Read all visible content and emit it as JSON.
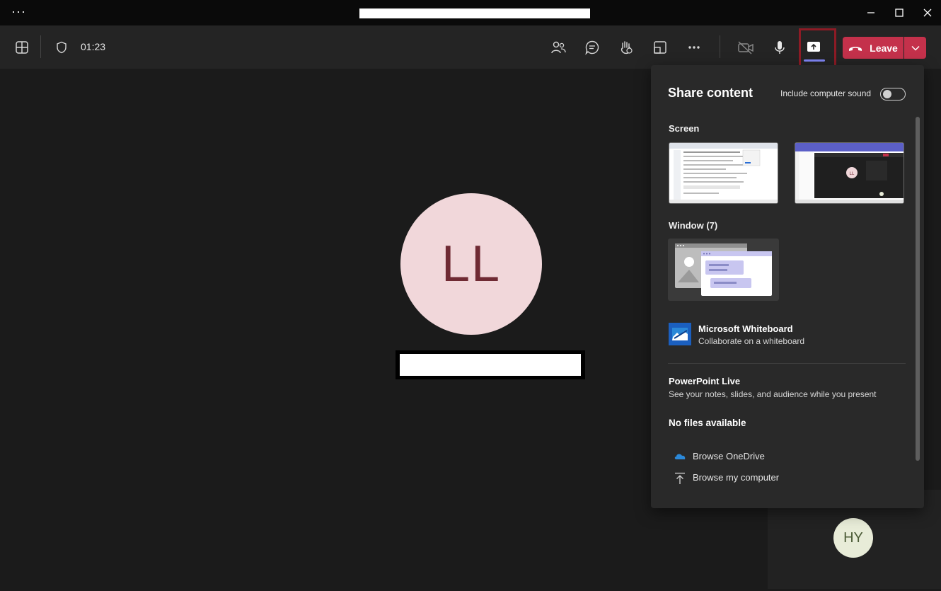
{
  "titlebar": {
    "more_label": "···"
  },
  "toolbar": {
    "timer": "01:23",
    "leave_label": "Leave"
  },
  "stage": {
    "main_initials": "LL",
    "self_initials": "HY"
  },
  "share_panel": {
    "title": "Share content",
    "include_sound_label": "Include computer sound",
    "include_sound_on": false,
    "screen_section": "Screen",
    "window_section": "Window (7)",
    "whiteboard": {
      "title": "Microsoft Whiteboard",
      "subtitle": "Collaborate on a whiteboard"
    },
    "powerpoint": {
      "title": "PowerPoint Live",
      "subtitle": "See your notes, slides, and audience while you present"
    },
    "no_files": "No files available",
    "browse_onedrive": "Browse OneDrive",
    "browse_computer": "Browse my computer"
  },
  "colors": {
    "leave": "#c4314b",
    "share_highlight": "#8d1b25",
    "accent": "#7f85f5"
  }
}
